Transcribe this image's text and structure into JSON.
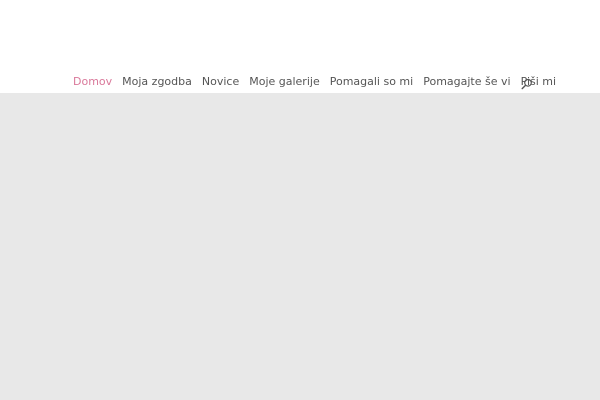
{
  "nav": {
    "items": [
      {
        "label": "Domov",
        "active": true
      },
      {
        "label": "Moja zgodba",
        "active": false
      },
      {
        "label": "Novice",
        "active": false
      },
      {
        "label": "Moje galerije",
        "active": false
      },
      {
        "label": "Pomagali so mi",
        "active": false
      },
      {
        "label": "Pomagajte še vi",
        "active": false
      },
      {
        "label": "Piši mi",
        "active": false
      }
    ],
    "search_icon": "search-icon"
  },
  "colors": {
    "active": "#d9789a",
    "text": "#555555",
    "content_bg": "#e8e8e8"
  }
}
